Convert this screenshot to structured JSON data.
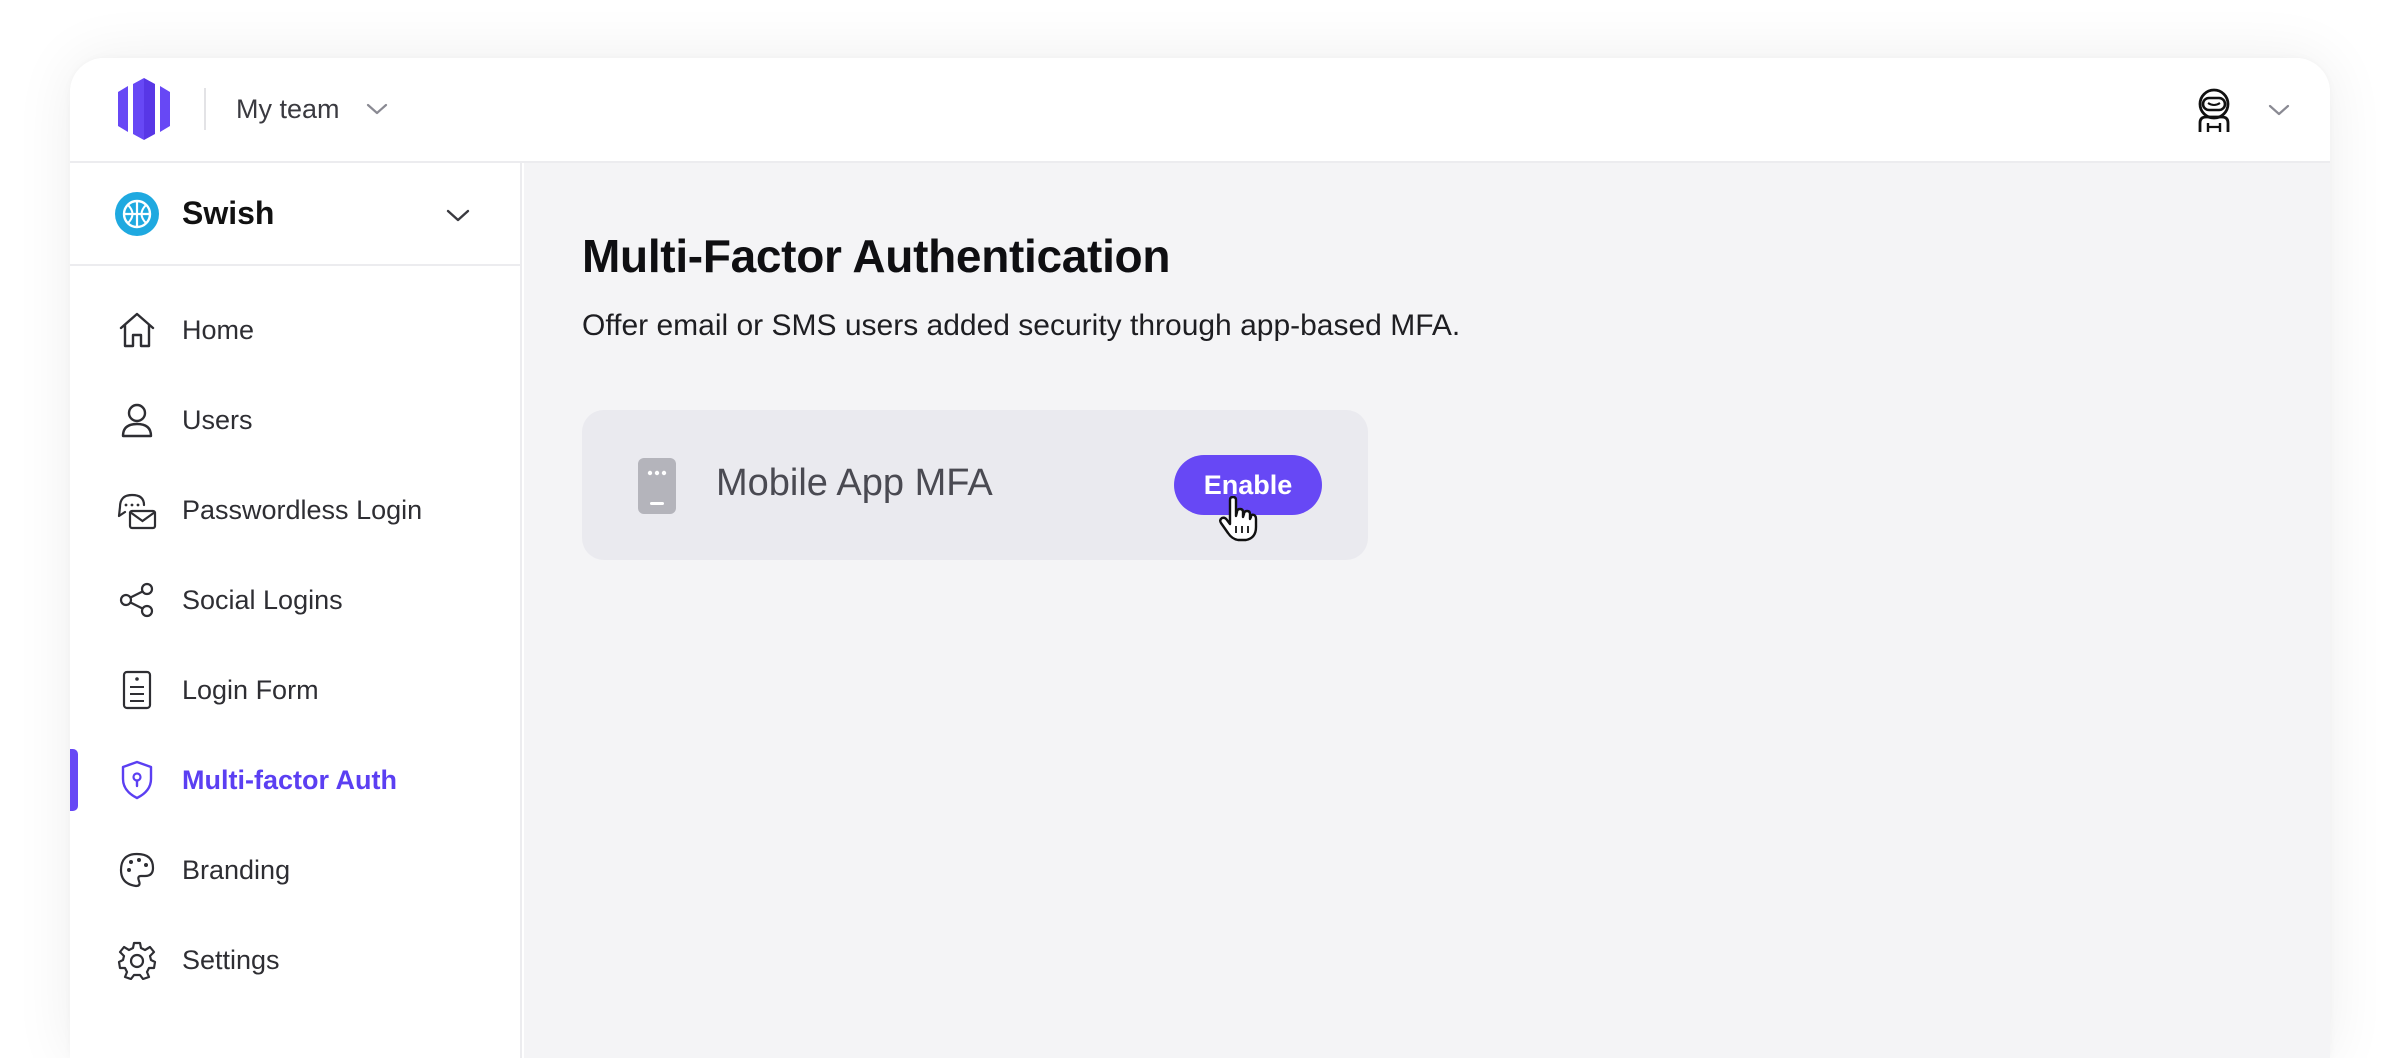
{
  "colors": {
    "accent": "#6748f5",
    "app_logo": "#1fa9e0",
    "content_bg": "#f4f4f6",
    "card_bg": "#eaeaef"
  },
  "header": {
    "logo_icon": "brand-logo-icon",
    "team": {
      "label": "My team",
      "icon": "chevron-down-icon"
    },
    "user": {
      "icon": "astronaut-avatar-icon",
      "dropdown_icon": "chevron-down-icon"
    }
  },
  "sidebar": {
    "app": {
      "name": "Swish",
      "icon": "basketball-icon",
      "dropdown_icon": "chevron-down-icon"
    },
    "items": [
      {
        "label": "Home",
        "icon": "home-icon",
        "active": false
      },
      {
        "label": "Users",
        "icon": "user-icon",
        "active": false
      },
      {
        "label": "Passwordless Login",
        "icon": "chat-mail-icon",
        "active": false
      },
      {
        "label": "Social Logins",
        "icon": "share-icon",
        "active": false
      },
      {
        "label": "Login Form",
        "icon": "form-document-icon",
        "active": false
      },
      {
        "label": "Multi-factor Auth",
        "icon": "shield-icon",
        "active": true
      },
      {
        "label": "Branding",
        "icon": "palette-icon",
        "active": false
      },
      {
        "label": "Settings",
        "icon": "gear-icon",
        "active": false
      }
    ]
  },
  "main": {
    "title": "Multi-Factor Authentication",
    "subtitle": "Offer email or SMS users added security through app-based MFA.",
    "card": {
      "icon": "mobile-device-icon",
      "label": "Mobile App MFA",
      "button_label": "Enable",
      "cursor_icon": "hand-pointer-cursor-icon"
    }
  }
}
